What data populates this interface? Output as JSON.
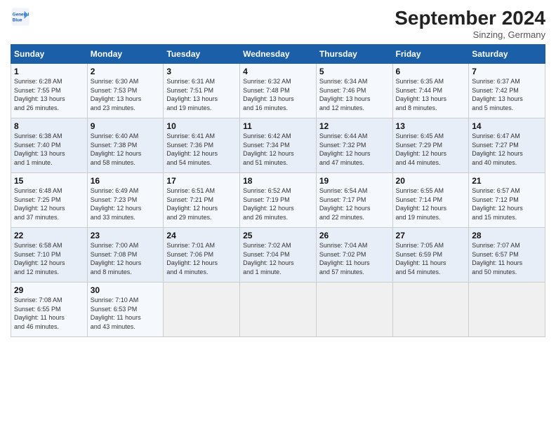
{
  "header": {
    "logo_text_general": "General",
    "logo_text_blue": "Blue",
    "month_title": "September 2024",
    "location": "Sinzing, Germany"
  },
  "weekdays": [
    "Sunday",
    "Monday",
    "Tuesday",
    "Wednesday",
    "Thursday",
    "Friday",
    "Saturday"
  ],
  "weeks": [
    [
      {
        "day": "1",
        "sunrise": "6:28 AM",
        "sunset": "7:55 PM",
        "daylight": "13 hours and 26 minutes."
      },
      {
        "day": "2",
        "sunrise": "6:30 AM",
        "sunset": "7:53 PM",
        "daylight": "13 hours and 23 minutes."
      },
      {
        "day": "3",
        "sunrise": "6:31 AM",
        "sunset": "7:51 PM",
        "daylight": "13 hours and 19 minutes."
      },
      {
        "day": "4",
        "sunrise": "6:32 AM",
        "sunset": "7:48 PM",
        "daylight": "13 hours and 16 minutes."
      },
      {
        "day": "5",
        "sunrise": "6:34 AM",
        "sunset": "7:46 PM",
        "daylight": "13 hours and 12 minutes."
      },
      {
        "day": "6",
        "sunrise": "6:35 AM",
        "sunset": "7:44 PM",
        "daylight": "13 hours and 8 minutes."
      },
      {
        "day": "7",
        "sunrise": "6:37 AM",
        "sunset": "7:42 PM",
        "daylight": "13 hours and 5 minutes."
      }
    ],
    [
      {
        "day": "8",
        "sunrise": "6:38 AM",
        "sunset": "7:40 PM",
        "daylight": "13 hours and 1 minute."
      },
      {
        "day": "9",
        "sunrise": "6:40 AM",
        "sunset": "7:38 PM",
        "daylight": "12 hours and 58 minutes."
      },
      {
        "day": "10",
        "sunrise": "6:41 AM",
        "sunset": "7:36 PM",
        "daylight": "12 hours and 54 minutes."
      },
      {
        "day": "11",
        "sunrise": "6:42 AM",
        "sunset": "7:34 PM",
        "daylight": "12 hours and 51 minutes."
      },
      {
        "day": "12",
        "sunrise": "6:44 AM",
        "sunset": "7:32 PM",
        "daylight": "12 hours and 47 minutes."
      },
      {
        "day": "13",
        "sunrise": "6:45 AM",
        "sunset": "7:29 PM",
        "daylight": "12 hours and 44 minutes."
      },
      {
        "day": "14",
        "sunrise": "6:47 AM",
        "sunset": "7:27 PM",
        "daylight": "12 hours and 40 minutes."
      }
    ],
    [
      {
        "day": "15",
        "sunrise": "6:48 AM",
        "sunset": "7:25 PM",
        "daylight": "12 hours and 37 minutes."
      },
      {
        "day": "16",
        "sunrise": "6:49 AM",
        "sunset": "7:23 PM",
        "daylight": "12 hours and 33 minutes."
      },
      {
        "day": "17",
        "sunrise": "6:51 AM",
        "sunset": "7:21 PM",
        "daylight": "12 hours and 29 minutes."
      },
      {
        "day": "18",
        "sunrise": "6:52 AM",
        "sunset": "7:19 PM",
        "daylight": "12 hours and 26 minutes."
      },
      {
        "day": "19",
        "sunrise": "6:54 AM",
        "sunset": "7:17 PM",
        "daylight": "12 hours and 22 minutes."
      },
      {
        "day": "20",
        "sunrise": "6:55 AM",
        "sunset": "7:14 PM",
        "daylight": "12 hours and 19 minutes."
      },
      {
        "day": "21",
        "sunrise": "6:57 AM",
        "sunset": "7:12 PM",
        "daylight": "12 hours and 15 minutes."
      }
    ],
    [
      {
        "day": "22",
        "sunrise": "6:58 AM",
        "sunset": "7:10 PM",
        "daylight": "12 hours and 12 minutes."
      },
      {
        "day": "23",
        "sunrise": "7:00 AM",
        "sunset": "7:08 PM",
        "daylight": "12 hours and 8 minutes."
      },
      {
        "day": "24",
        "sunrise": "7:01 AM",
        "sunset": "7:06 PM",
        "daylight": "12 hours and 4 minutes."
      },
      {
        "day": "25",
        "sunrise": "7:02 AM",
        "sunset": "7:04 PM",
        "daylight": "12 hours and 1 minute."
      },
      {
        "day": "26",
        "sunrise": "7:04 AM",
        "sunset": "7:02 PM",
        "daylight": "11 hours and 57 minutes."
      },
      {
        "day": "27",
        "sunrise": "7:05 AM",
        "sunset": "6:59 PM",
        "daylight": "11 hours and 54 minutes."
      },
      {
        "day": "28",
        "sunrise": "7:07 AM",
        "sunset": "6:57 PM",
        "daylight": "11 hours and 50 minutes."
      }
    ],
    [
      {
        "day": "29",
        "sunrise": "7:08 AM",
        "sunset": "6:55 PM",
        "daylight": "11 hours and 46 minutes."
      },
      {
        "day": "30",
        "sunrise": "7:10 AM",
        "sunset": "6:53 PM",
        "daylight": "11 hours and 43 minutes."
      },
      null,
      null,
      null,
      null,
      null
    ]
  ]
}
